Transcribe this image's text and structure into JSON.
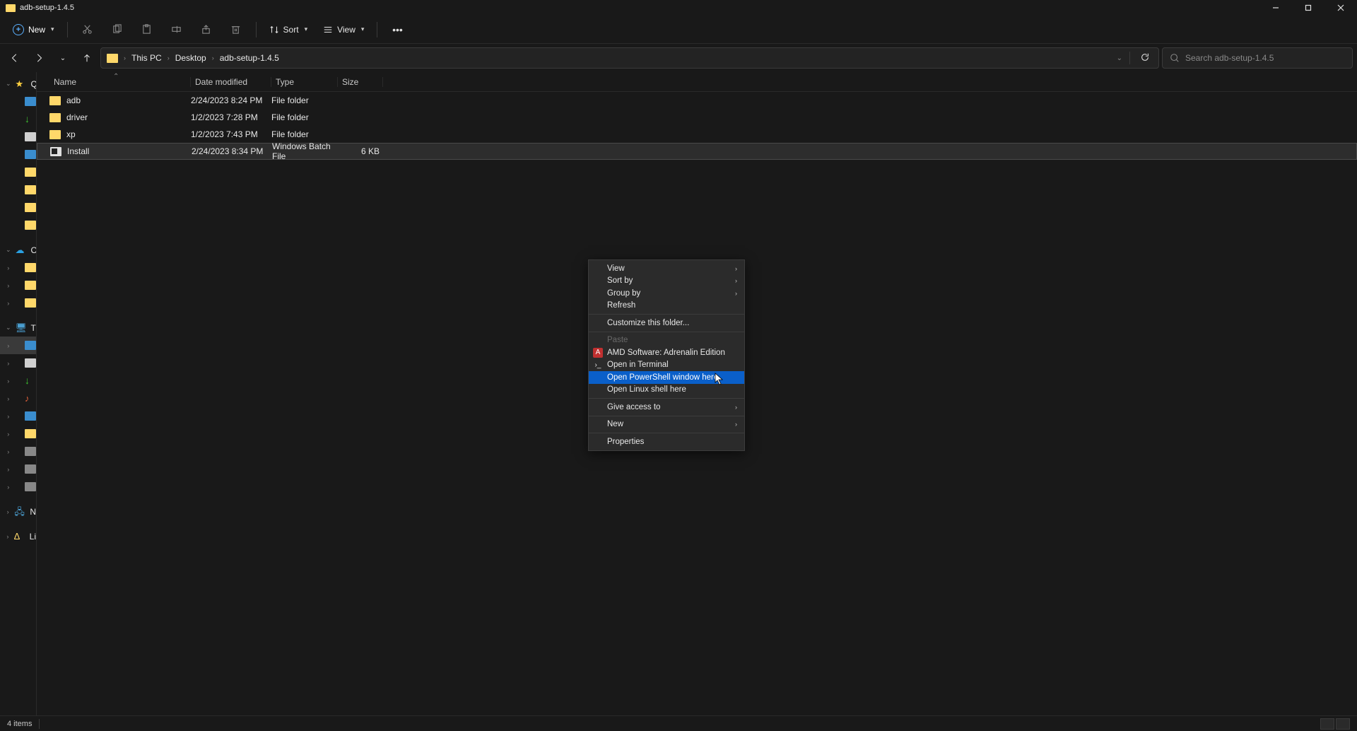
{
  "window": {
    "title": "adb-setup-1.4.5"
  },
  "toolbar": {
    "new": "New",
    "sort": "Sort",
    "view": "View"
  },
  "breadcrumbs": [
    "This PC",
    "Desktop",
    "adb-setup-1.4.5"
  ],
  "search": {
    "placeholder": "Search adb-setup-1.4.5"
  },
  "columns": {
    "name": "Name",
    "date": "Date modified",
    "type": "Type",
    "size": "Size"
  },
  "files": [
    {
      "icon": "folder",
      "name": "adb",
      "date": "2/24/2023 8:24 PM",
      "type": "File folder",
      "size": ""
    },
    {
      "icon": "folder",
      "name": "driver",
      "date": "1/2/2023 7:28 PM",
      "type": "File folder",
      "size": ""
    },
    {
      "icon": "folder",
      "name": "xp",
      "date": "1/2/2023 7:43 PM",
      "type": "File folder",
      "size": ""
    },
    {
      "icon": "bat",
      "name": "Install",
      "date": "2/24/2023 8:34 PM",
      "type": "Windows Batch File",
      "size": "6 KB",
      "selected": true
    }
  ],
  "sidebar": {
    "quick_label": "Q",
    "onedrive_label": "O",
    "thispc_label": "TI",
    "network_label": "N",
    "linux_label": "Li"
  },
  "context_menu": {
    "view": "View",
    "sort_by": "Sort by",
    "group_by": "Group by",
    "refresh": "Refresh",
    "customize": "Customize this folder...",
    "paste": "Paste",
    "amd": "AMD Software: Adrenalin Edition",
    "open_terminal": "Open in Terminal",
    "open_powershell": "Open PowerShell window here",
    "open_linux": "Open Linux shell here",
    "give_access": "Give access to",
    "new": "New",
    "properties": "Properties"
  },
  "status": {
    "count": "4 items"
  }
}
